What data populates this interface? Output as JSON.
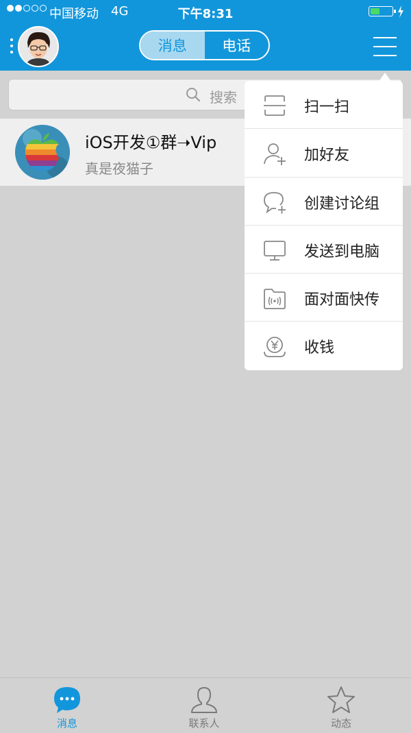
{
  "status_bar": {
    "signal_dots_filled": 2,
    "signal_dots_total": 5,
    "carrier": "中国移动",
    "network": "4G",
    "time": "下午8:31",
    "battery_level": 0.45,
    "battery_color": "#4cd964"
  },
  "header": {
    "tabs": [
      {
        "label": "消息",
        "active": true
      },
      {
        "label": "电话",
        "active": false
      }
    ],
    "menu_icon": "hamburger-icon",
    "profile_menu_icon": "more-dots-icon"
  },
  "search": {
    "placeholder": "搜索",
    "icon": "search-icon"
  },
  "conversations": [
    {
      "title": "iOS开发①群➝Vip",
      "last_message": "真是夜猫子",
      "avatar": "apple-logo-avatar"
    }
  ],
  "popup_menu": {
    "items": [
      {
        "label": "扫一扫",
        "icon": "scan-icon"
      },
      {
        "label": "加好友",
        "icon": "add-friend-icon"
      },
      {
        "label": "创建讨论组",
        "icon": "create-group-chat-icon"
      },
      {
        "label": "发送到电脑",
        "icon": "computer-icon"
      },
      {
        "label": "面对面快传",
        "icon": "face-to-face-transfer-icon"
      },
      {
        "label": "收钱",
        "icon": "receive-money-icon"
      }
    ]
  },
  "tab_bar": {
    "items": [
      {
        "label": "消息",
        "icon": "chat-bubble-icon",
        "active": true
      },
      {
        "label": "联系人",
        "icon": "contacts-icon",
        "active": false
      },
      {
        "label": "动态",
        "icon": "star-icon",
        "active": false
      }
    ]
  },
  "colors": {
    "brand": "#1296db",
    "background": "#d2d2d2",
    "active_tab": "#1296db",
    "inactive_tab": "#7a7a7a"
  }
}
